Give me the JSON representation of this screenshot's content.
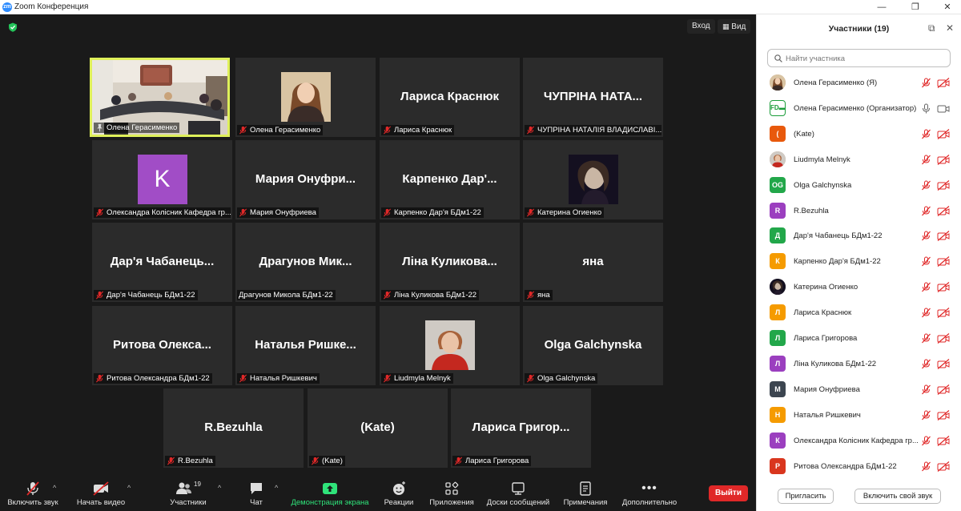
{
  "window": {
    "title": "Zoom Конференция",
    "logo_text": "zm"
  },
  "meeting": {
    "top_buttons": {
      "exit_fullscreen": "Вход",
      "view": "Вид"
    },
    "tiles": [
      {
        "display": "",
        "label": "Олена Герасименко",
        "kind": "photo-room",
        "active": true,
        "pinned": true
      },
      {
        "display": "",
        "label": "Олена Герасименко",
        "kind": "photo-woman"
      },
      {
        "display": "Лариса Краснюк",
        "label": "Лариса Краснюк"
      },
      {
        "display": "ЧУПРІНА НАТА...",
        "label": "ЧУПРІНА НАТАЛІЯ ВЛАДИСЛАВІ..."
      },
      {
        "display": "K",
        "label": "Олександра Колісник Кафедра гр...",
        "kind": "letter",
        "color": "#a14dc6"
      },
      {
        "display": "Мария Онуфри...",
        "label": "Мария Онуфриева"
      },
      {
        "display": "Карпенко Дар'...",
        "label": "Карпенко Дар'я БДм1-22"
      },
      {
        "display": "",
        "label": "Катерина Огиенко",
        "kind": "photo-dark"
      },
      {
        "display": "Дар'я Чабанець...",
        "label": "Дар'я Чабанець БДм1-22"
      },
      {
        "display": "Драгунов Мик...",
        "label": "Драгунов Микола БДм1-22",
        "nomic": true
      },
      {
        "display": "Ліна Куликова...",
        "label": "Ліна Куликова БДм1-22"
      },
      {
        "display": "яна",
        "label": "яна"
      },
      {
        "display": "Ритова Олекса...",
        "label": "Ритова Олександра БДм1-22"
      },
      {
        "display": "Наталья Ришке...",
        "label": "Наталья Ришкевич"
      },
      {
        "display": "",
        "label": "Liudmyla Melnyk",
        "kind": "photo-portrait"
      },
      {
        "display": "Olga Galchynska",
        "label": "Olga Galchynska"
      },
      {
        "display": "R.Bezuhla",
        "label": "R.Bezuhla"
      },
      {
        "display": "(Kate)",
        "label": "(Kate)"
      },
      {
        "display": "Лариса Григор...",
        "label": "Лариса Григорова"
      }
    ]
  },
  "toolbar": {
    "audio": "Включить звук",
    "video": "Начать видео",
    "participants": "Участники",
    "participants_count": "19",
    "chat": "Чат",
    "share": "Демонстрация экрана",
    "reactions": "Реакции",
    "apps": "Приложения",
    "whiteboards": "Доски сообщений",
    "notes": "Примечания",
    "more": "Дополнительно",
    "leave": "Выйти"
  },
  "panel": {
    "title": "Участники (19)",
    "search_placeholder": "Найти участника",
    "participants": [
      {
        "name": "Олена Герасименко (Я)",
        "avatar": "photo-woman",
        "color": "#c89b6d"
      },
      {
        "name": "Олена Герасименко (Организатор)",
        "avatar": "fd",
        "color": "#ffffff",
        "mic_on": true
      },
      {
        "name": "(Kate)",
        "avatar": "(",
        "color": "#e8590c"
      },
      {
        "name": "Liudmyla Melnyk",
        "avatar": "photo-portrait",
        "color": "#b58a6a"
      },
      {
        "name": "Olga Galchynska",
        "avatar": "OG",
        "color": "#22a74a"
      },
      {
        "name": "R.Bezuhla",
        "avatar": "R",
        "color": "#9b3fbf"
      },
      {
        "name": "Дар'я Чабанець БДм1-22",
        "avatar": "Д",
        "color": "#22a74a"
      },
      {
        "name": "Карпенко Дар'я БДм1-22",
        "avatar": "К",
        "color": "#f59b00"
      },
      {
        "name": "Катерина Огиенко",
        "avatar": "photo-dark",
        "color": "#2a2233"
      },
      {
        "name": "Лариса Краснюк",
        "avatar": "Л",
        "color": "#f59b00"
      },
      {
        "name": "Лариса Григорова",
        "avatar": "Л",
        "color": "#22a74a"
      },
      {
        "name": "Ліна Куликова БДм1-22",
        "avatar": "Л",
        "color": "#9b3fbf"
      },
      {
        "name": "Мария Онуфриева",
        "avatar": "М",
        "color": "#3c4550"
      },
      {
        "name": "Наталья Ришкевич",
        "avatar": "Н",
        "color": "#f59b00"
      },
      {
        "name": "Олександра Колісник Кафедра гр...",
        "avatar": "К",
        "color": "#9b3fbf"
      },
      {
        "name": "Ритова Олександра БДм1-22",
        "avatar": "Р",
        "color": "#d9361e"
      }
    ],
    "invite": "Пригласить",
    "unmute_self": "Включить свой звук"
  }
}
